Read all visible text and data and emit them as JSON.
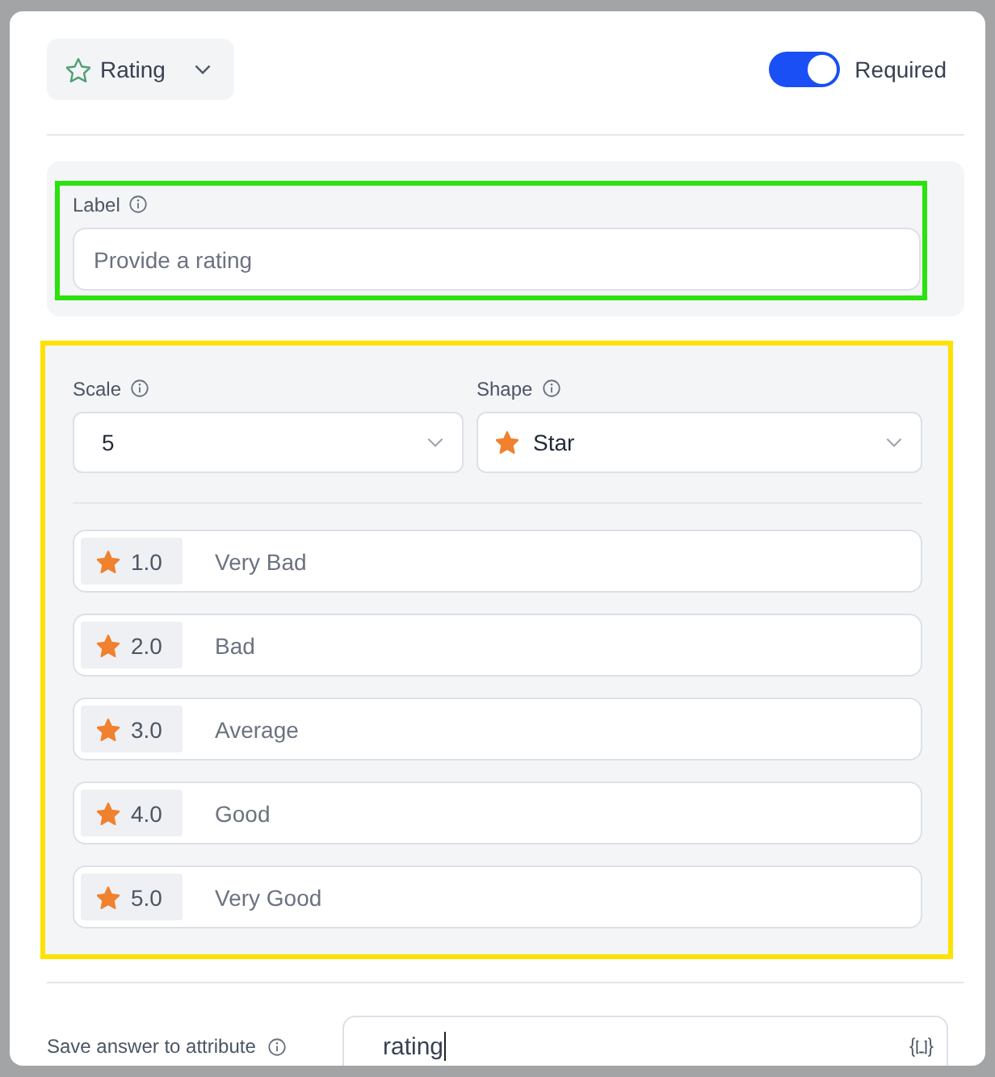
{
  "field_type": {
    "label": "Rating"
  },
  "required": {
    "label": "Required",
    "on": true
  },
  "label_section": {
    "highlighted": true,
    "label": "Label",
    "placeholder": "Provide a rating"
  },
  "scale_section": {
    "highlighted": true,
    "scale": {
      "label": "Scale",
      "value": "5"
    },
    "shape": {
      "label": "Shape",
      "value": "Star"
    },
    "options": [
      {
        "value": "1.0",
        "label": "Very Bad"
      },
      {
        "value": "2.0",
        "label": "Bad"
      },
      {
        "value": "3.0",
        "label": "Average"
      },
      {
        "value": "4.0",
        "label": "Good"
      },
      {
        "value": "5.0",
        "label": "Very Good"
      }
    ]
  },
  "attribute": {
    "label": "Save answer to attribute",
    "value": "rating",
    "focused": true
  }
}
